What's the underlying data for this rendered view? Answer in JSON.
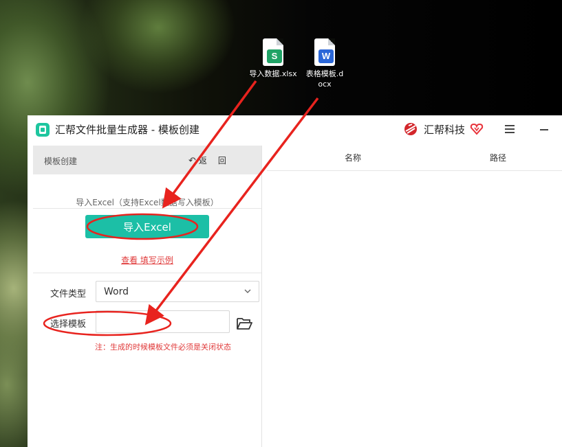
{
  "desktop": {
    "icons": [
      {
        "name": "导入数据.xlsx",
        "badge": "S",
        "badge_color": "#20a366"
      },
      {
        "name": "表格模板.docx",
        "badge": "W",
        "badge_color": "#2b67d8"
      }
    ]
  },
  "window": {
    "title": "汇帮文件批量生成器 - 模板创建",
    "brand": "汇帮科技",
    "icons": {
      "menu": "hamburger-menu-icon",
      "minimize": "minimize-icon",
      "vip": "vip-heart-icon"
    }
  },
  "left_panel": {
    "header_title": "模板创建",
    "back_label": "返回",
    "import_hint": "导入Excel（支持Excel数据写入模板）",
    "import_button": "导入Excel",
    "example_link": "查看 填写示例",
    "file_type_label": "文件类型",
    "file_type_value": "Word",
    "template_label": "选择模板",
    "template_value": "",
    "note": "注：生成的时候模板文件必须是关闭状态"
  },
  "right_panel": {
    "columns": [
      "名称",
      "路径"
    ]
  },
  "colors": {
    "accent": "#1cbfa6",
    "warning_text": "#e03a3a",
    "annotation": "#e8231e"
  }
}
